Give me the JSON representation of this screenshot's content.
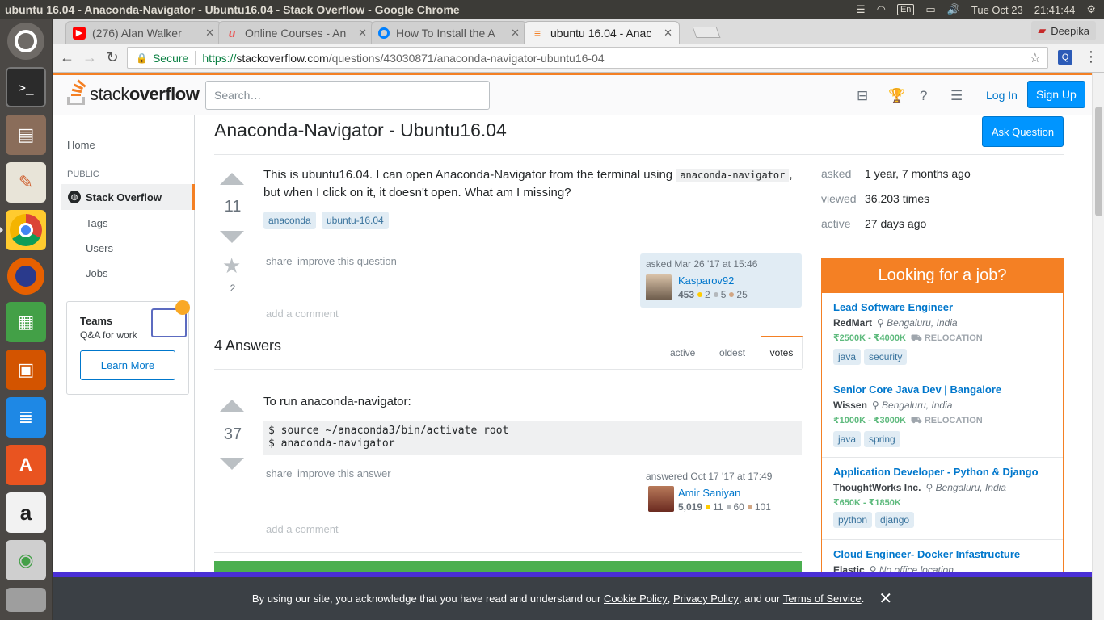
{
  "system": {
    "window_title": "ubuntu 16.04 - Anaconda-Navigator - Ubuntu16.04 - Stack Overflow - Google Chrome",
    "keyboard_layout": "En",
    "datetime": "Tue Oct 23",
    "clock": "21:41:44"
  },
  "launcher": [
    "ubuntu-dash-icon",
    "terminal-icon",
    "file-manager-icon",
    "text-editor-icon",
    "chrome-icon",
    "firefox-icon",
    "calc-icon",
    "impress-icon",
    "writer-icon",
    "software-center-icon",
    "amazon-icon",
    "disk-icon",
    "trash-icon"
  ],
  "browser": {
    "tabs": [
      {
        "title": "(276) Alan Walker",
        "favicon": "youtube-icon",
        "color": "#ff0000"
      },
      {
        "title": "Online Courses - An",
        "favicon": "udemy-icon",
        "color": "#ec5252"
      },
      {
        "title": "How To Install the A",
        "favicon": "digitalocean-icon",
        "color": "#0080ff"
      },
      {
        "title": "ubuntu 16.04 - Anac",
        "favicon": "stackoverflow-icon",
        "color": "#f48024"
      }
    ],
    "profile_name": "Deepika",
    "secure_label": "Secure",
    "url_scheme": "https://",
    "url_host": "stackoverflow.com",
    "url_path": "/questions/43030871/anaconda-navigator-ubuntu16-04"
  },
  "header": {
    "logo_plain": "stack",
    "logo_bold": "overflow",
    "search_placeholder": "Search…",
    "login": "Log In",
    "signup": "Sign Up"
  },
  "sidebar": {
    "home": "Home",
    "public": "PUBLIC",
    "stack_overflow": "Stack Overflow",
    "tags": "Tags",
    "users": "Users",
    "jobs": "Jobs",
    "teams_title": "Teams",
    "teams_sub": "Q&A for work",
    "learn_more": "Learn More"
  },
  "question": {
    "title": "Anaconda-Navigator - Ubuntu16.04",
    "ask_button": "Ask Question",
    "votes": "11",
    "favorites": "2",
    "body_1": "This is ubuntu16.04. I can open Anaconda-Navigator from the terminal using ",
    "body_code": "anaconda-navigator",
    "body_2": ", but when I click on it, it doesn't open. What am I missing?",
    "tags": [
      "anaconda",
      "ubuntu-16.04"
    ],
    "share": "share",
    "improve": "improve this question",
    "add_comment": "add a comment",
    "asked": "asked Mar 26 '17 at 15:46",
    "user": "Kasparov92",
    "rep": "453",
    "gold": "2",
    "silver": "5",
    "bronze": "25"
  },
  "stats": {
    "asked_label": "asked",
    "asked_value": "1 year, 7 months ago",
    "viewed_label": "viewed",
    "viewed_value": "36,203 times",
    "active_label": "active",
    "active_value": "27 days ago"
  },
  "answers": {
    "count_label": "4 Answers",
    "sort": [
      "active",
      "oldest",
      "votes"
    ],
    "sort_selected": "votes",
    "items": [
      {
        "votes": "37",
        "intro": "To run anaconda-navigator:",
        "code_line1": "$ source ~/anaconda3/bin/activate root",
        "code_line2": "$ anaconda-navigator",
        "share": "share",
        "improve": "improve this answer",
        "answered": "answered Oct 17 '17 at 17:49",
        "user": "Amir Saniyan",
        "rep": "5,019",
        "gold": "11",
        "silver": "60",
        "bronze": "101",
        "add_comment": "add a comment"
      }
    ]
  },
  "jobs": {
    "heading": "Looking for a job?",
    "relocation": "RELOCATION",
    "items": [
      {
        "title": "Lead Software Engineer",
        "company": "RedMart",
        "location": "Bengaluru, India",
        "salary": "₹2500K - ₹4000K",
        "reloc": true,
        "tags": [
          "java",
          "security"
        ]
      },
      {
        "title": "Senior Core Java Dev | Bangalore",
        "company": "Wissen",
        "location": "Bengaluru, India",
        "salary": "₹1000K - ₹3000K",
        "reloc": true,
        "tags": [
          "java",
          "spring"
        ]
      },
      {
        "title": "Application Developer - Python & Django",
        "company": "ThoughtWorks Inc.",
        "location": "Bengaluru, India",
        "salary": "₹650K - ₹1850K",
        "reloc": false,
        "tags": [
          "python",
          "django"
        ]
      },
      {
        "title": "Cloud Engineer- Docker Infastructure",
        "company": "Elastic",
        "location": "No office location",
        "salary": "",
        "reloc": false,
        "tags": []
      }
    ]
  },
  "cookie": {
    "text_1": "By using our site, you acknowledge that you have read and understand our ",
    "cookie_policy": "Cookie Policy",
    "text_2": ", ",
    "privacy_policy": "Privacy Policy",
    "text_3": ", and our ",
    "terms": "Terms of Service",
    "text_4": "."
  },
  "colors": {
    "so_orange": "#f48024",
    "link_blue": "#0077cc",
    "button_blue": "#0095ff",
    "tag_bg": "#e1ecf4",
    "salary_green": "#5eba7d"
  }
}
